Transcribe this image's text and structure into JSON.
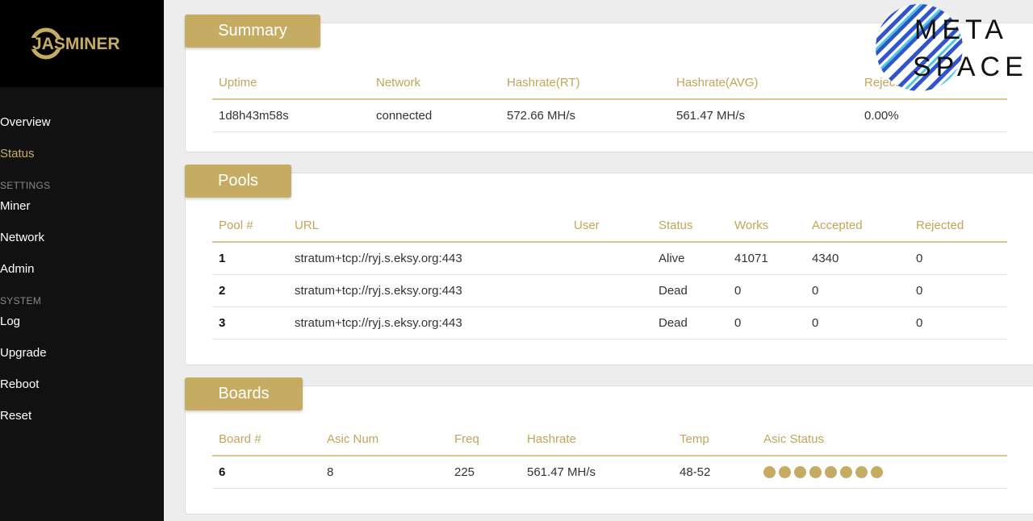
{
  "brand": {
    "logo_text": "JASMINER",
    "accent": "#c6ac63"
  },
  "sidebar": {
    "items": [
      {
        "label": "Overview",
        "active": false
      },
      {
        "label": "Status",
        "active": true
      }
    ],
    "settings_label": "SETTINGS",
    "settings_items": [
      {
        "label": "Miner"
      },
      {
        "label": "Network"
      },
      {
        "label": "Admin"
      }
    ],
    "system_label": "SYSTEM",
    "system_items": [
      {
        "label": "Log"
      },
      {
        "label": "Upgrade"
      },
      {
        "label": "Reboot"
      },
      {
        "label": "Reset"
      }
    ]
  },
  "summary": {
    "title": "Summary",
    "headers": [
      "Uptime",
      "Network",
      "Hashrate(RT)",
      "Hashrate(AVG)",
      "Rejected"
    ],
    "row": [
      "1d8h43m58s",
      "connected",
      "572.66 MH/s",
      "561.47 MH/s",
      "0.00%"
    ]
  },
  "pools": {
    "title": "Pools",
    "headers": [
      "Pool #",
      "URL",
      "User",
      "Status",
      "Works",
      "Accepted",
      "Rejected"
    ],
    "rows": [
      [
        "1",
        "stratum+tcp://ryj.s.eksy.org:443",
        "",
        "Alive",
        "41071",
        "4340",
        "0"
      ],
      [
        "2",
        "stratum+tcp://ryj.s.eksy.org:443",
        "",
        "Dead",
        "0",
        "0",
        "0"
      ],
      [
        "3",
        "stratum+tcp://ryj.s.eksy.org:443",
        "",
        "Dead",
        "0",
        "0",
        "0"
      ]
    ]
  },
  "boards": {
    "title": "Boards",
    "headers": [
      "Board #",
      "Asic Num",
      "Freq",
      "Hashrate",
      "Temp",
      "Asic Status"
    ],
    "rows": [
      {
        "board": "6",
        "asic_num": "8",
        "freq": "225",
        "hashrate": "561.47 MH/s",
        "temp": "48-52",
        "asic_status_count": 8
      }
    ]
  },
  "watermark": {
    "line1": "META",
    "line2": "SPACE"
  }
}
